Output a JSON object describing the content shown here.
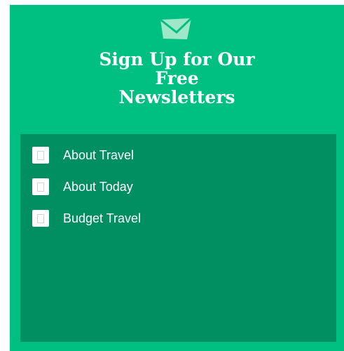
{
  "widget": {
    "icon": "envelope-icon",
    "title_lines": [
      "Sign Up for Our",
      "Free",
      "Newsletters"
    ],
    "colors": {
      "background": "#00c081",
      "panel": "#018e61",
      "text": "#ffffff"
    }
  },
  "newsletters": [
    {
      "label": "About Travel",
      "checked": false
    },
    {
      "label": "About Today",
      "checked": false
    },
    {
      "label": "Budget Travel",
      "checked": false
    }
  ]
}
